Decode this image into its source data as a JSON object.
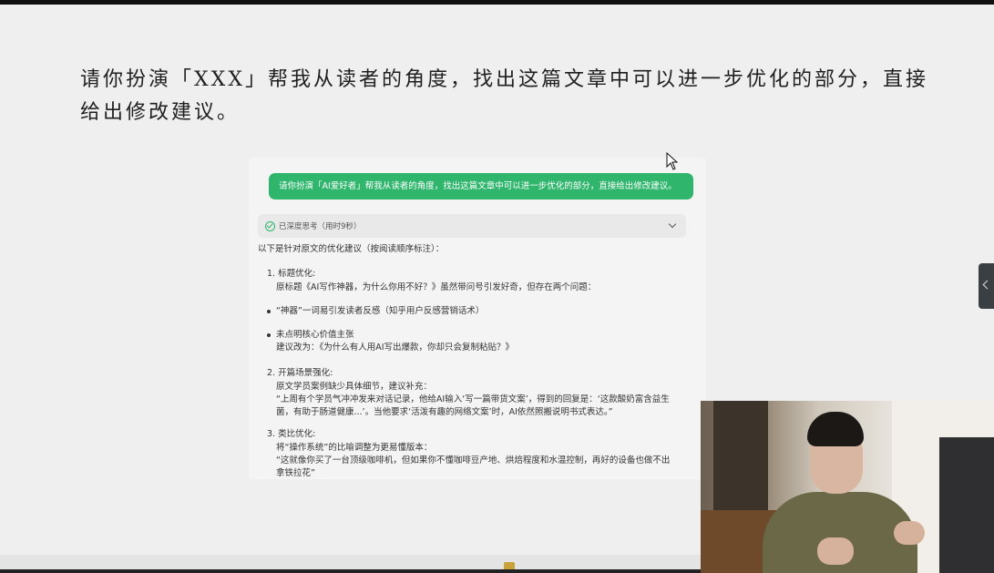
{
  "headline": "请你扮演「XXX」帮我从读者的角度，找出这篇文章中可以进一步优化的部分，直接给出修改建议。",
  "chat": {
    "user_message": "请你扮演「AI爱好者」帮我从读者的角度，找出这篇文章中可以进一步优化的部分，直接给出修改建议。",
    "thinking_label": "已深度思考（用时9秒）",
    "intro": "以下是针对原文的优化建议（按阅读顺序标注）：",
    "sections": [
      {
        "title": "1. 标题优化:",
        "lines": [
          "原标题《AI写作神器，为什么你用不好？》虽然带问号引发好奇，但存在两个问题："
        ],
        "bullets": [
          [
            "“神器”一词易引发读者反感（知乎用户反感营销话术）"
          ],
          [
            "未点明核心价值主张",
            "建议改为：《为什么有人用AI写出爆款，你却只会复制粘贴？》"
          ]
        ]
      },
      {
        "title": "2. 开篇场景强化:",
        "lines": [
          "原文学员案例缺少具体细节，建议补充：",
          "“上周有个学员气冲冲发来对话记录，他给AI输入‘写一篇带货文案’，得到的回复是：‘这款酸奶富含益生",
          "菌，有助于肠道健康...’。当他要求‘活泼有趣的网络文案’时，AI依然照搬说明书式表达。”"
        ]
      },
      {
        "title": "3. 类比优化:",
        "lines": [
          "将“操作系统”的比喻调整为更易懂版本：",
          "“这就像你买了一台顶级咖啡机，但如果你不懂咖啡豆产地、烘焙程度和水温控制，再好的设备也做不出",
          "拿铁拉花”"
        ]
      }
    ]
  },
  "colors": {
    "accent": "#2fb66c",
    "background": "#efefef"
  },
  "icons": {
    "check": "check-circle-icon",
    "chevron": "chevron-down-icon",
    "cursor": "mouse-cursor-icon",
    "side_tab": "chevron-left-icon"
  }
}
